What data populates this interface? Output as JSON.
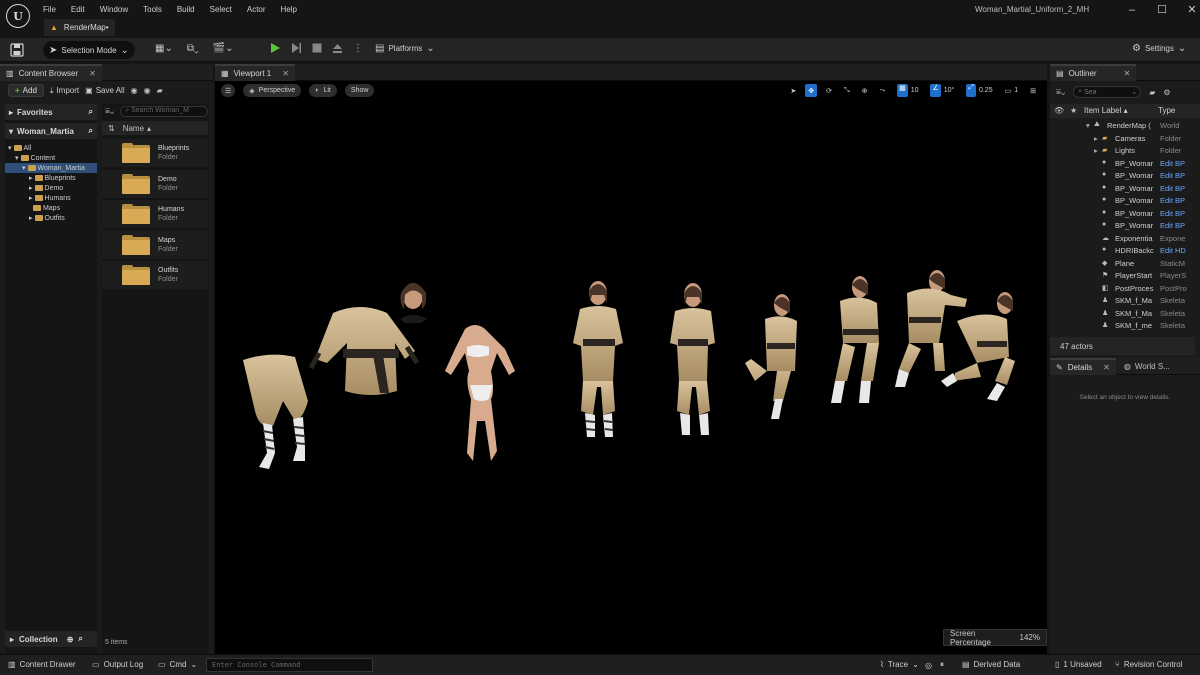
{
  "app": {
    "logo_text": "U",
    "menu": [
      "File",
      "Edit",
      "Window",
      "Tools",
      "Build",
      "Select",
      "Actor",
      "Help"
    ],
    "level_tab": "RenderMap•",
    "project_name": "Woman_Martial_Uniform_2_MH",
    "window_controls": [
      "–",
      "☐",
      "✕"
    ]
  },
  "toolbar": {
    "selection_mode": "Selection Mode",
    "platforms": "Platforms",
    "settings": "Settings"
  },
  "content_browser": {
    "title": "Content Browser",
    "add_label": "Add",
    "import_label": "Import",
    "save_all_label": "Save All",
    "favorites_label": "Favorites",
    "project_label": "Woman_Martia",
    "search_placeholder": "Search Woman_M",
    "name_header": "Name",
    "tree": [
      {
        "label": "All",
        "level": 0
      },
      {
        "label": "Content",
        "level": 1
      },
      {
        "label": "Woman_Martia",
        "level": 2
      },
      {
        "label": "Blueprints",
        "level": 3
      },
      {
        "label": "Demo",
        "level": 3
      },
      {
        "label": "Humans",
        "level": 3
      },
      {
        "label": "Maps",
        "level": 3
      },
      {
        "label": "Outfits",
        "level": 3
      }
    ],
    "assets": [
      {
        "name": "Blueprints",
        "type": "Folder"
      },
      {
        "name": "Demo",
        "type": "Folder"
      },
      {
        "name": "Humans",
        "type": "Folder"
      },
      {
        "name": "Maps",
        "type": "Folder"
      },
      {
        "name": "Outfits",
        "type": "Folder"
      }
    ],
    "collection_label": "Collection",
    "items_count": "5 items"
  },
  "viewport": {
    "title": "Viewport 1",
    "perspective": "Perspective",
    "lit": "Lit",
    "show": "Show",
    "grid_snap": "10",
    "rot_snap": "10°",
    "scale_snap": "0.25",
    "camera_speed": "1",
    "screen_percentage_label": "Screen Percentage",
    "screen_percentage_value": "142%"
  },
  "outliner": {
    "title": "Outliner",
    "search_placeholder": "Sea",
    "col_label": "Item Label",
    "col_type": "Type",
    "rows": [
      {
        "label": "RenderMap (",
        "type": "World",
        "icon": "map-icon",
        "link": false
      },
      {
        "label": "Cameras",
        "type": "Folder",
        "icon": "folder-icon",
        "link": false
      },
      {
        "label": "Lights",
        "type": "Folder",
        "icon": "folder-icon",
        "link": false
      },
      {
        "label": "BP_Womar",
        "type": "Edit BP",
        "icon": "blueprint-icon",
        "link": true
      },
      {
        "label": "BP_Womar",
        "type": "Edit BP",
        "icon": "blueprint-icon",
        "link": true
      },
      {
        "label": "BP_Womar",
        "type": "Edit BP",
        "icon": "blueprint-icon",
        "link": true
      },
      {
        "label": "BP_Womar",
        "type": "Edit BP",
        "icon": "blueprint-icon",
        "link": true
      },
      {
        "label": "BP_Womar",
        "type": "Edit BP",
        "icon": "blueprint-icon",
        "link": true
      },
      {
        "label": "BP_Womar",
        "type": "Edit BP",
        "icon": "blueprint-icon",
        "link": true
      },
      {
        "label": "Exponentia",
        "type": "Expone",
        "icon": "fog-icon",
        "link": false
      },
      {
        "label": "HDRIBackc",
        "type": "Edit HD",
        "icon": "blueprint-icon",
        "link": true
      },
      {
        "label": "Plane",
        "type": "StaticM",
        "icon": "mesh-icon",
        "link": false
      },
      {
        "label": "PlayerStart",
        "type": "PlayerS",
        "icon": "player-icon",
        "link": false
      },
      {
        "label": "PostProces",
        "type": "PostPro",
        "icon": "postprocess-icon",
        "link": false
      },
      {
        "label": "SKM_f_Ma",
        "type": "Skeleta",
        "icon": "skeletal-icon",
        "link": false
      },
      {
        "label": "SKM_f_Ma",
        "type": "Skeleta",
        "icon": "skeletal-icon",
        "link": false
      },
      {
        "label": "SKM_f_me",
        "type": "Skeleta",
        "icon": "skeletal-icon",
        "link": false
      }
    ],
    "actor_count": "47 actors"
  },
  "details": {
    "title": "Details",
    "world_settings": "World S...",
    "empty_message": "Select an object to view details."
  },
  "statusbar": {
    "content_drawer": "Content Drawer",
    "output_log": "Output Log",
    "cmd": "Cmd",
    "console_placeholder": "Enter Console Command",
    "trace": "Trace",
    "derived_data": "Derived Data",
    "unsaved": "1 Unsaved",
    "revision_control": "Revision Control"
  },
  "colors": {
    "accent": "#1f6fcc",
    "folder": "#d8aa55",
    "play": "#5fbf3f",
    "link": "#6aa6ff"
  }
}
